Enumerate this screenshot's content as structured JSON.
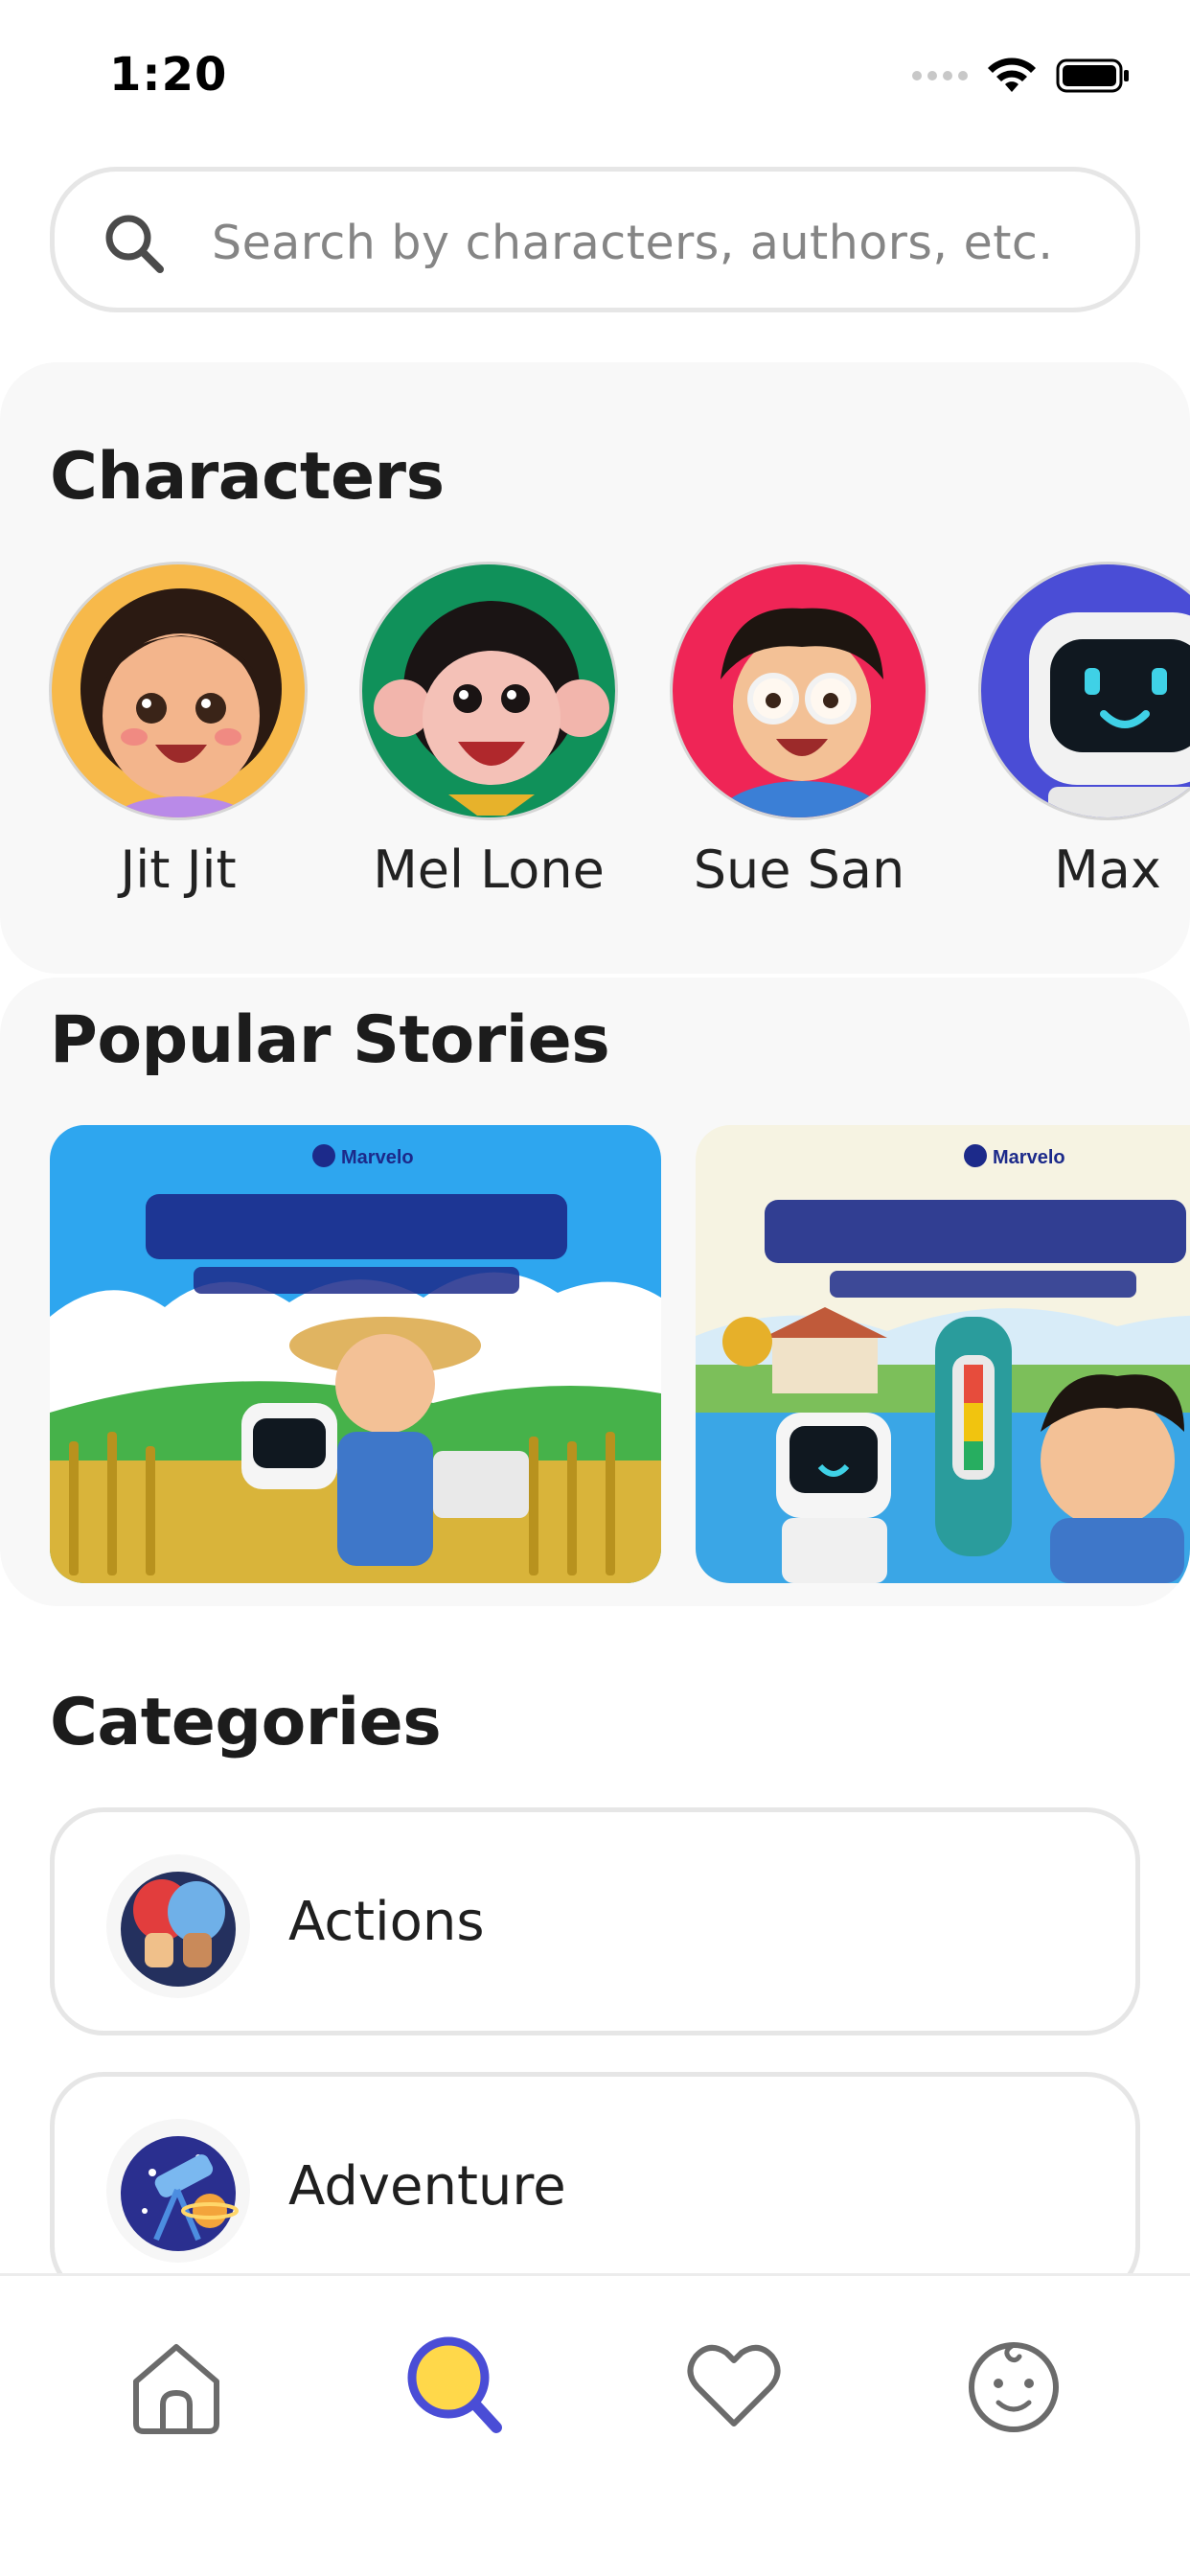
{
  "status_bar": {
    "time": "1:20"
  },
  "search": {
    "placeholder": "Search by characters, authors, etc."
  },
  "characters": {
    "title": "Characters",
    "items": [
      {
        "name": "Jit Jit",
        "bg": "#f7b94a"
      },
      {
        "name": "Mel Lone",
        "bg": "#10915a"
      },
      {
        "name": "Sue San",
        "bg": "#ef2556"
      },
      {
        "name": "Max",
        "bg": "#4a4dd6"
      }
    ]
  },
  "popular_stories": {
    "title": "Popular Stories",
    "items": [
      {
        "brand": "Marvelo",
        "sky": "#2ea6ef"
      },
      {
        "brand": "Marvelo",
        "sky": "#f6f3e2"
      }
    ]
  },
  "categories": {
    "title": "Categories",
    "items": [
      {
        "label": "Actions",
        "icon": "boxing-gloves-icon"
      },
      {
        "label": "Adventure",
        "icon": "telescope-icon"
      }
    ]
  },
  "bottom_nav": {
    "items": [
      {
        "icon": "home-icon"
      },
      {
        "icon": "search-icon",
        "active": true
      },
      {
        "icon": "heart-icon"
      },
      {
        "icon": "baby-face-icon"
      }
    ],
    "accent": "#4a4dd6",
    "accent_fill": "#ffd84a"
  }
}
